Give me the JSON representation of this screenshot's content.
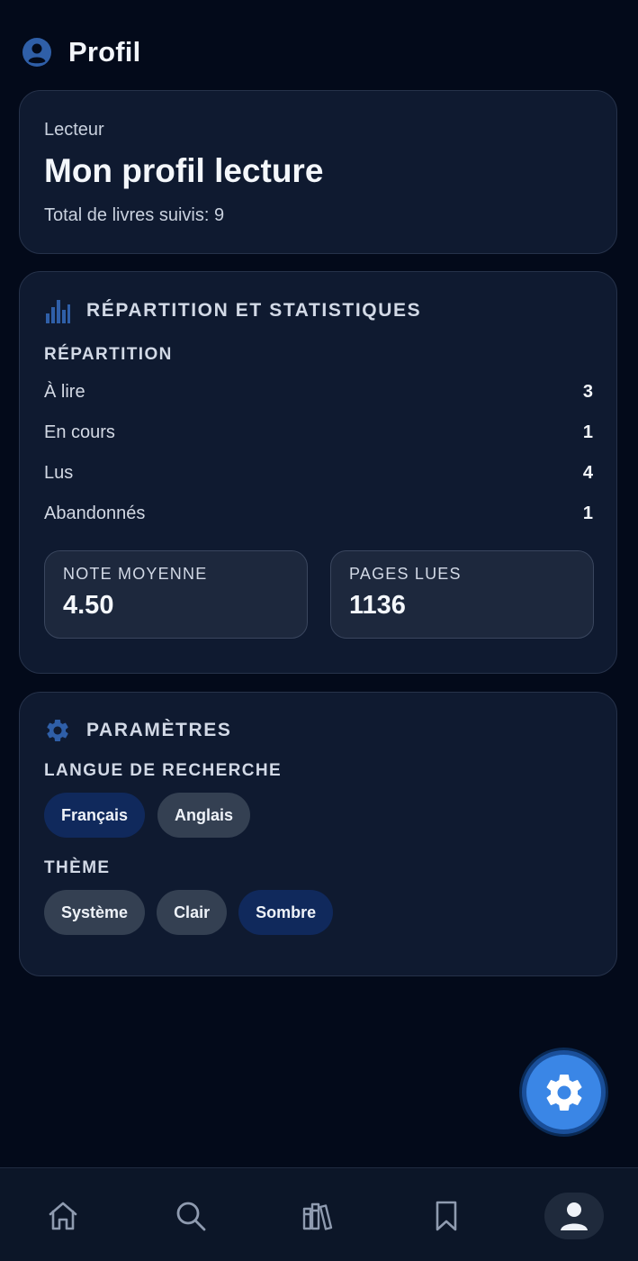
{
  "header": {
    "title": "Profil",
    "icon": "account-circle-icon"
  },
  "profile_card": {
    "eyebrow": "Lecteur",
    "title": "Mon profil lecture",
    "subtitle": "Total de livres suivis: 9"
  },
  "stats_card": {
    "heading": "RÉPARTITION ET STATISTIQUES",
    "icon": "bar-chart-icon",
    "sub_heading": "RÉPARTITION",
    "rows": [
      {
        "label": "À lire",
        "value": "3"
      },
      {
        "label": "En cours",
        "value": "1"
      },
      {
        "label": "Lus",
        "value": "4"
      },
      {
        "label": "Abandonnés",
        "value": "1"
      }
    ],
    "metrics": [
      {
        "label": "NOTE MOYENNE",
        "value": "4.50"
      },
      {
        "label": "PAGES LUES",
        "value": "1136"
      }
    ]
  },
  "settings_card": {
    "heading": "PARAMÈTRES",
    "icon": "gear-icon",
    "language_label": "LANGUE DE RECHERCHE",
    "language_options": [
      {
        "label": "Français",
        "selected": true
      },
      {
        "label": "Anglais",
        "selected": false
      }
    ],
    "theme_label": "THÈME",
    "theme_options": [
      {
        "label": "Système",
        "selected": false
      },
      {
        "label": "Clair",
        "selected": false
      },
      {
        "label": "Sombre",
        "selected": true
      }
    ]
  },
  "fab": {
    "icon": "gear-icon"
  },
  "bottom_nav": {
    "items": [
      {
        "icon": "home-icon",
        "active": false
      },
      {
        "icon": "search-icon",
        "active": false
      },
      {
        "icon": "library-icon",
        "active": false
      },
      {
        "icon": "bookmark-icon",
        "active": false
      },
      {
        "icon": "profile-icon",
        "active": true
      }
    ]
  },
  "colors": {
    "background": "#030a1a",
    "card": "#0f1a30",
    "accent": "#3a86e6",
    "icon_blue": "#2f5fa8",
    "chip_active": "#10295c",
    "chip_inactive": "#344052"
  }
}
